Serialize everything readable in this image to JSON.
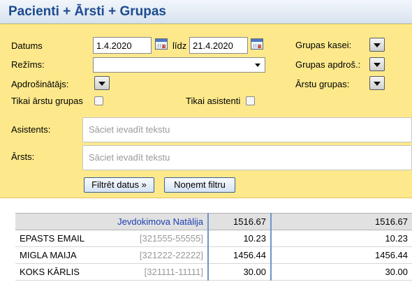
{
  "header": {
    "title": "Pacienti + Ārsti + Grupas"
  },
  "filters": {
    "datums_label": "Datums",
    "date_from": "1.4.2020",
    "lidz_label": "līdz",
    "date_to": "21.4.2020",
    "rezims_label": "Režīms:",
    "rezims_value": "",
    "apdrosinatajs_label": "Apdrošinātājs:",
    "grupas_kasei_label": "Grupas kasei:",
    "grupas_apdros_label": "Grupas apdroš.:",
    "arstu_grupas_label": "Ārstu grupas:",
    "tikai_arstu_grupas_label": "Tikai ārstu grupas",
    "tikai_asistenti_label": "Tikai asistenti",
    "asistents_label": "Asistents:",
    "asistents_placeholder": "Sāciet ievadīt tekstu",
    "arsts_label": "Ārsts:",
    "arsts_placeholder": "Sāciet ievadīt tekstu",
    "filter_button": "Filtrēt datus »",
    "clear_button": "Noņemt filtru"
  },
  "results": {
    "group": {
      "name": "Jevdokimova Natālija",
      "v1": "1516.67",
      "v2": "1516.67"
    },
    "rows": [
      {
        "name": "EPASTS EMAIL",
        "code": "[321555-55555]",
        "v1": "10.23",
        "v2": "10.23"
      },
      {
        "name": "MIGLA MAIJA",
        "code": "[321222-22222]",
        "v1": "1456.44",
        "v2": "1456.44"
      },
      {
        "name": "KOKS KĀRLIS",
        "code": "[321111-11111]",
        "v1": "30.00",
        "v2": "30.00"
      }
    ]
  },
  "colors": {
    "panel": "#fde98b",
    "title": "#1d4b8f",
    "group_link": "#1d3fb5",
    "column_divider": "#6d95c8"
  },
  "icons": {
    "calendar": "calendar-icon",
    "dropdown": "dropdown-arrow-icon"
  }
}
